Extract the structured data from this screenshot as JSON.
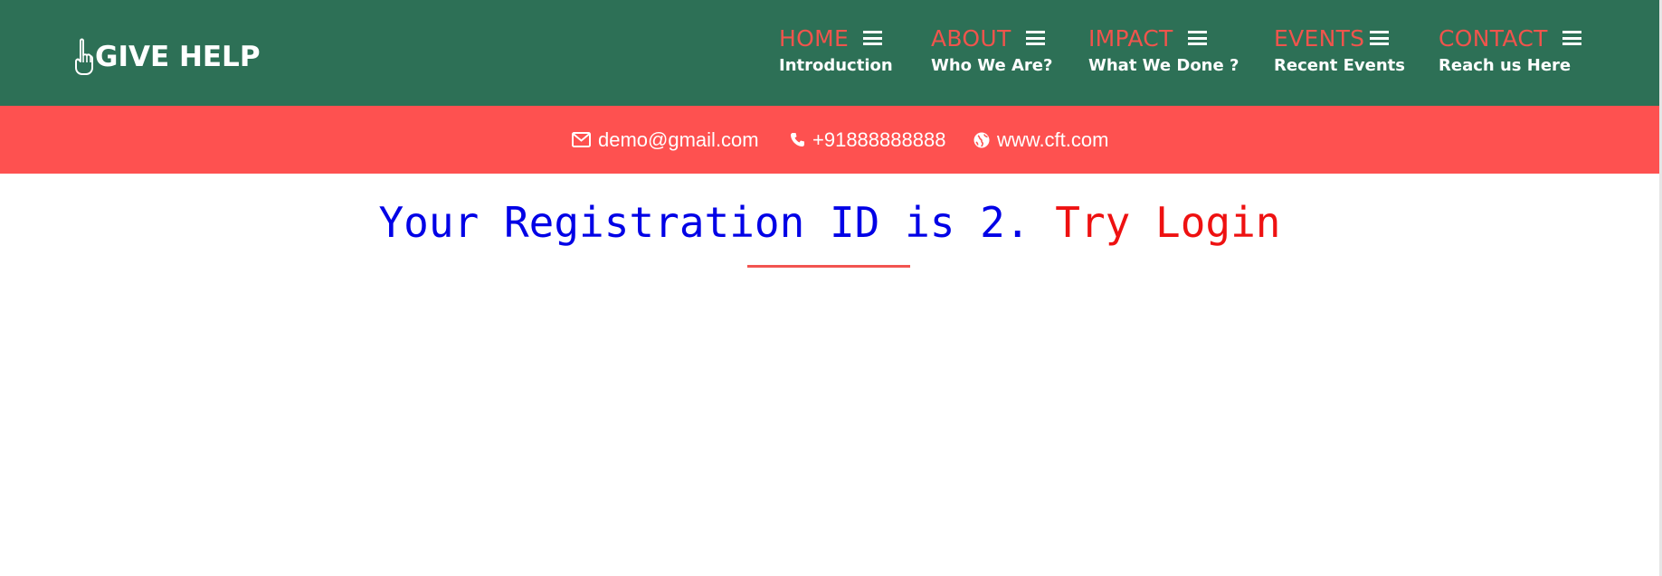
{
  "brand": {
    "logo_text": "GIVE HELP",
    "logo_icon": "pointing-hand-icon"
  },
  "nav": {
    "items": [
      {
        "title": "HOME",
        "subtitle": "Introduction",
        "icon": "hamburger-menu-icon"
      },
      {
        "title": "ABOUT",
        "subtitle": "Who We Are?",
        "icon": "hamburger-menu-icon"
      },
      {
        "title": "IMPACT",
        "subtitle": "What We Done ?",
        "icon": "hamburger-menu-icon"
      },
      {
        "title": "EVENTS",
        "subtitle": "Recent Events",
        "icon": "hamburger-menu-icon"
      },
      {
        "title": "CONTACT",
        "subtitle": "Reach us Here",
        "icon": "hamburger-menu-icon"
      }
    ]
  },
  "contact": {
    "email": "demo@gmail.com",
    "phone": "+91888888888",
    "website": "www.cft.com",
    "email_icon": "envelope-icon",
    "phone_icon": "phone-icon",
    "website_icon": "globe-icon"
  },
  "message": {
    "text": "Your Registration ID is 2.",
    "link": "Try Login"
  },
  "colors": {
    "header_bg": "#2d7056",
    "contact_bar_bg": "#fe5150",
    "nav_title": "#f0544c",
    "message_text": "#0000e6",
    "message_link": "#ee1111",
    "divider": "#f25450"
  }
}
